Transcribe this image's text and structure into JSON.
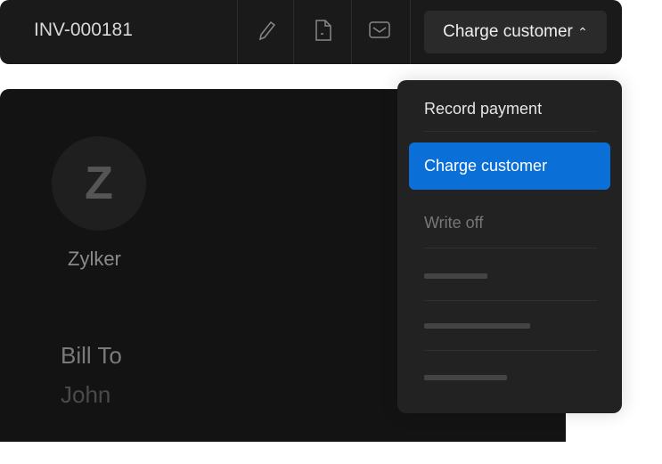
{
  "header": {
    "invoice_number": "INV-000181",
    "charge_button_label": "Charge customer",
    "icons": [
      "pencil-icon",
      "file-icon",
      "mail-icon",
      "chevron-up-icon"
    ]
  },
  "invoice": {
    "avatar_letter": "Z",
    "company_name": "Zylker",
    "bill_to_label": "Bill To",
    "customer_name": "John"
  },
  "menu": {
    "items": [
      {
        "label": "Record payment"
      },
      {
        "label": "Charge customer",
        "active": true
      },
      {
        "label": "Write off",
        "disabled": true
      }
    ],
    "accent_color": "#0a6fd6"
  }
}
